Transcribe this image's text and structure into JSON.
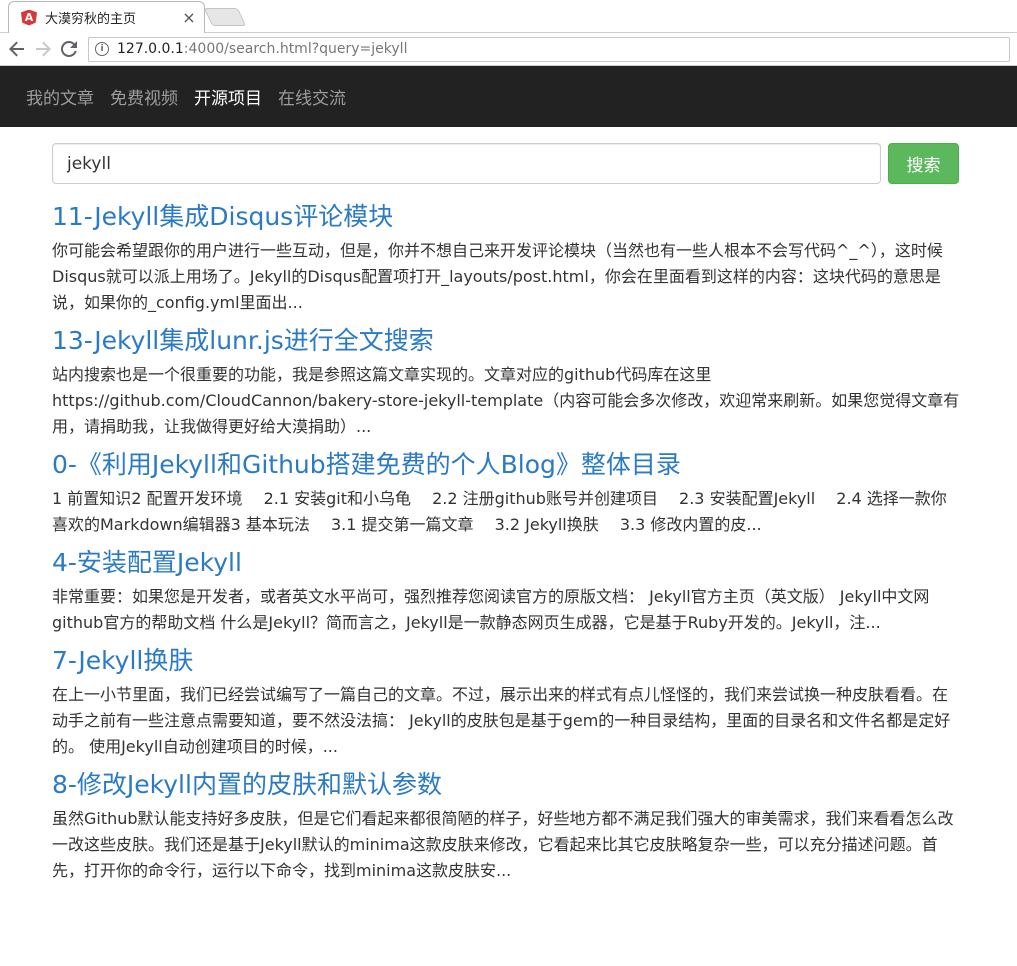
{
  "browser": {
    "tab_title": "大漠穷秋的主页",
    "tab_close": "×",
    "url_host": "127.0.0.1",
    "url_rest": ":4000/search.html?query=jekyll"
  },
  "navbar": {
    "items": [
      {
        "label": "我的文章",
        "active": false
      },
      {
        "label": "免费视频",
        "active": false
      },
      {
        "label": "开源项目",
        "active": true
      },
      {
        "label": "在线交流",
        "active": false
      }
    ]
  },
  "search": {
    "value": "jekyll",
    "button_label": "搜索"
  },
  "results": [
    {
      "title": "11-Jekyll集成Disqus评论模块",
      "snippet": "你可能会希望跟你的用户进行一些互动，但是，你并不想自己来开发评论模块（当然也有一些人根本不会写代码^_^），这时候Disqus就可以派上用场了。Jekyll的Disqus配置项打开_layouts/post.html，你会在里面看到这样的内容：这块代码的意思是说，如果你的_config.yml里面出..."
    },
    {
      "title": "13-Jekyll集成lunr.js进行全文搜索",
      "snippet": "站内搜索也是一个很重要的功能，我是参照这篇文章实现的。文章对应的github代码库在这里https://github.com/CloudCannon/bakery-store-jekyll-template（内容可能会多次修改，欢迎常来刷新。如果您觉得文章有用，请捐助我，让我做得更好给大漠捐助）..."
    },
    {
      "title": "0-《利用Jekyll和Github搭建免费的个人Blog》整体目录",
      "snippet": "1 前置知识2 配置开发环境　 2.1 安装git和小乌龟　 2.2 注册github账号并创建项目　 2.3 安装配置Jekyll　 2.4 选择一款你喜欢的Markdown编辑器3 基本玩法　 3.1 提交第一篇文章　 3.2 Jekyll换肤　 3.3 修改内置的皮..."
    },
    {
      "title": "4-安装配置Jekyll",
      "snippet": "非常重要：如果您是开发者，或者英文水平尚可，强烈推荐您阅读官方的原版文档： Jekyll官方主页（英文版） Jekyll中文网 github官方的帮助文档 什么是Jekyll？简而言之，Jekyll是一款静态网页生成器，它是基于Ruby开发的。Jekyll，注..."
    },
    {
      "title": "7-Jekyll换肤",
      "snippet": "在上一小节里面，我们已经尝试编写了一篇自己的文章。不过，展示出来的样式有点儿怪怪的，我们来尝试换一种皮肤看看。在动手之前有一些注意点需要知道，要不然没法搞： Jekyll的皮肤包是基于gem的一种目录结构，里面的目录名和文件名都是定好的。 使用Jekyll自动创建项目的时候，..."
    },
    {
      "title": "8-修改Jekyll内置的皮肤和默认参数",
      "snippet": "虽然Github默认能支持好多皮肤，但是它们看起来都很简陋的样子，好些地方都不满足我们强大的审美需求，我们来看看怎么改一改这些皮肤。我们还是基于Jekyll默认的minima这款皮肤来修改，它看起来比其它皮肤略复杂一些，可以充分描述问题。首先，打开你的命令行，运行以下命令，找到minima这款皮肤安..."
    }
  ]
}
